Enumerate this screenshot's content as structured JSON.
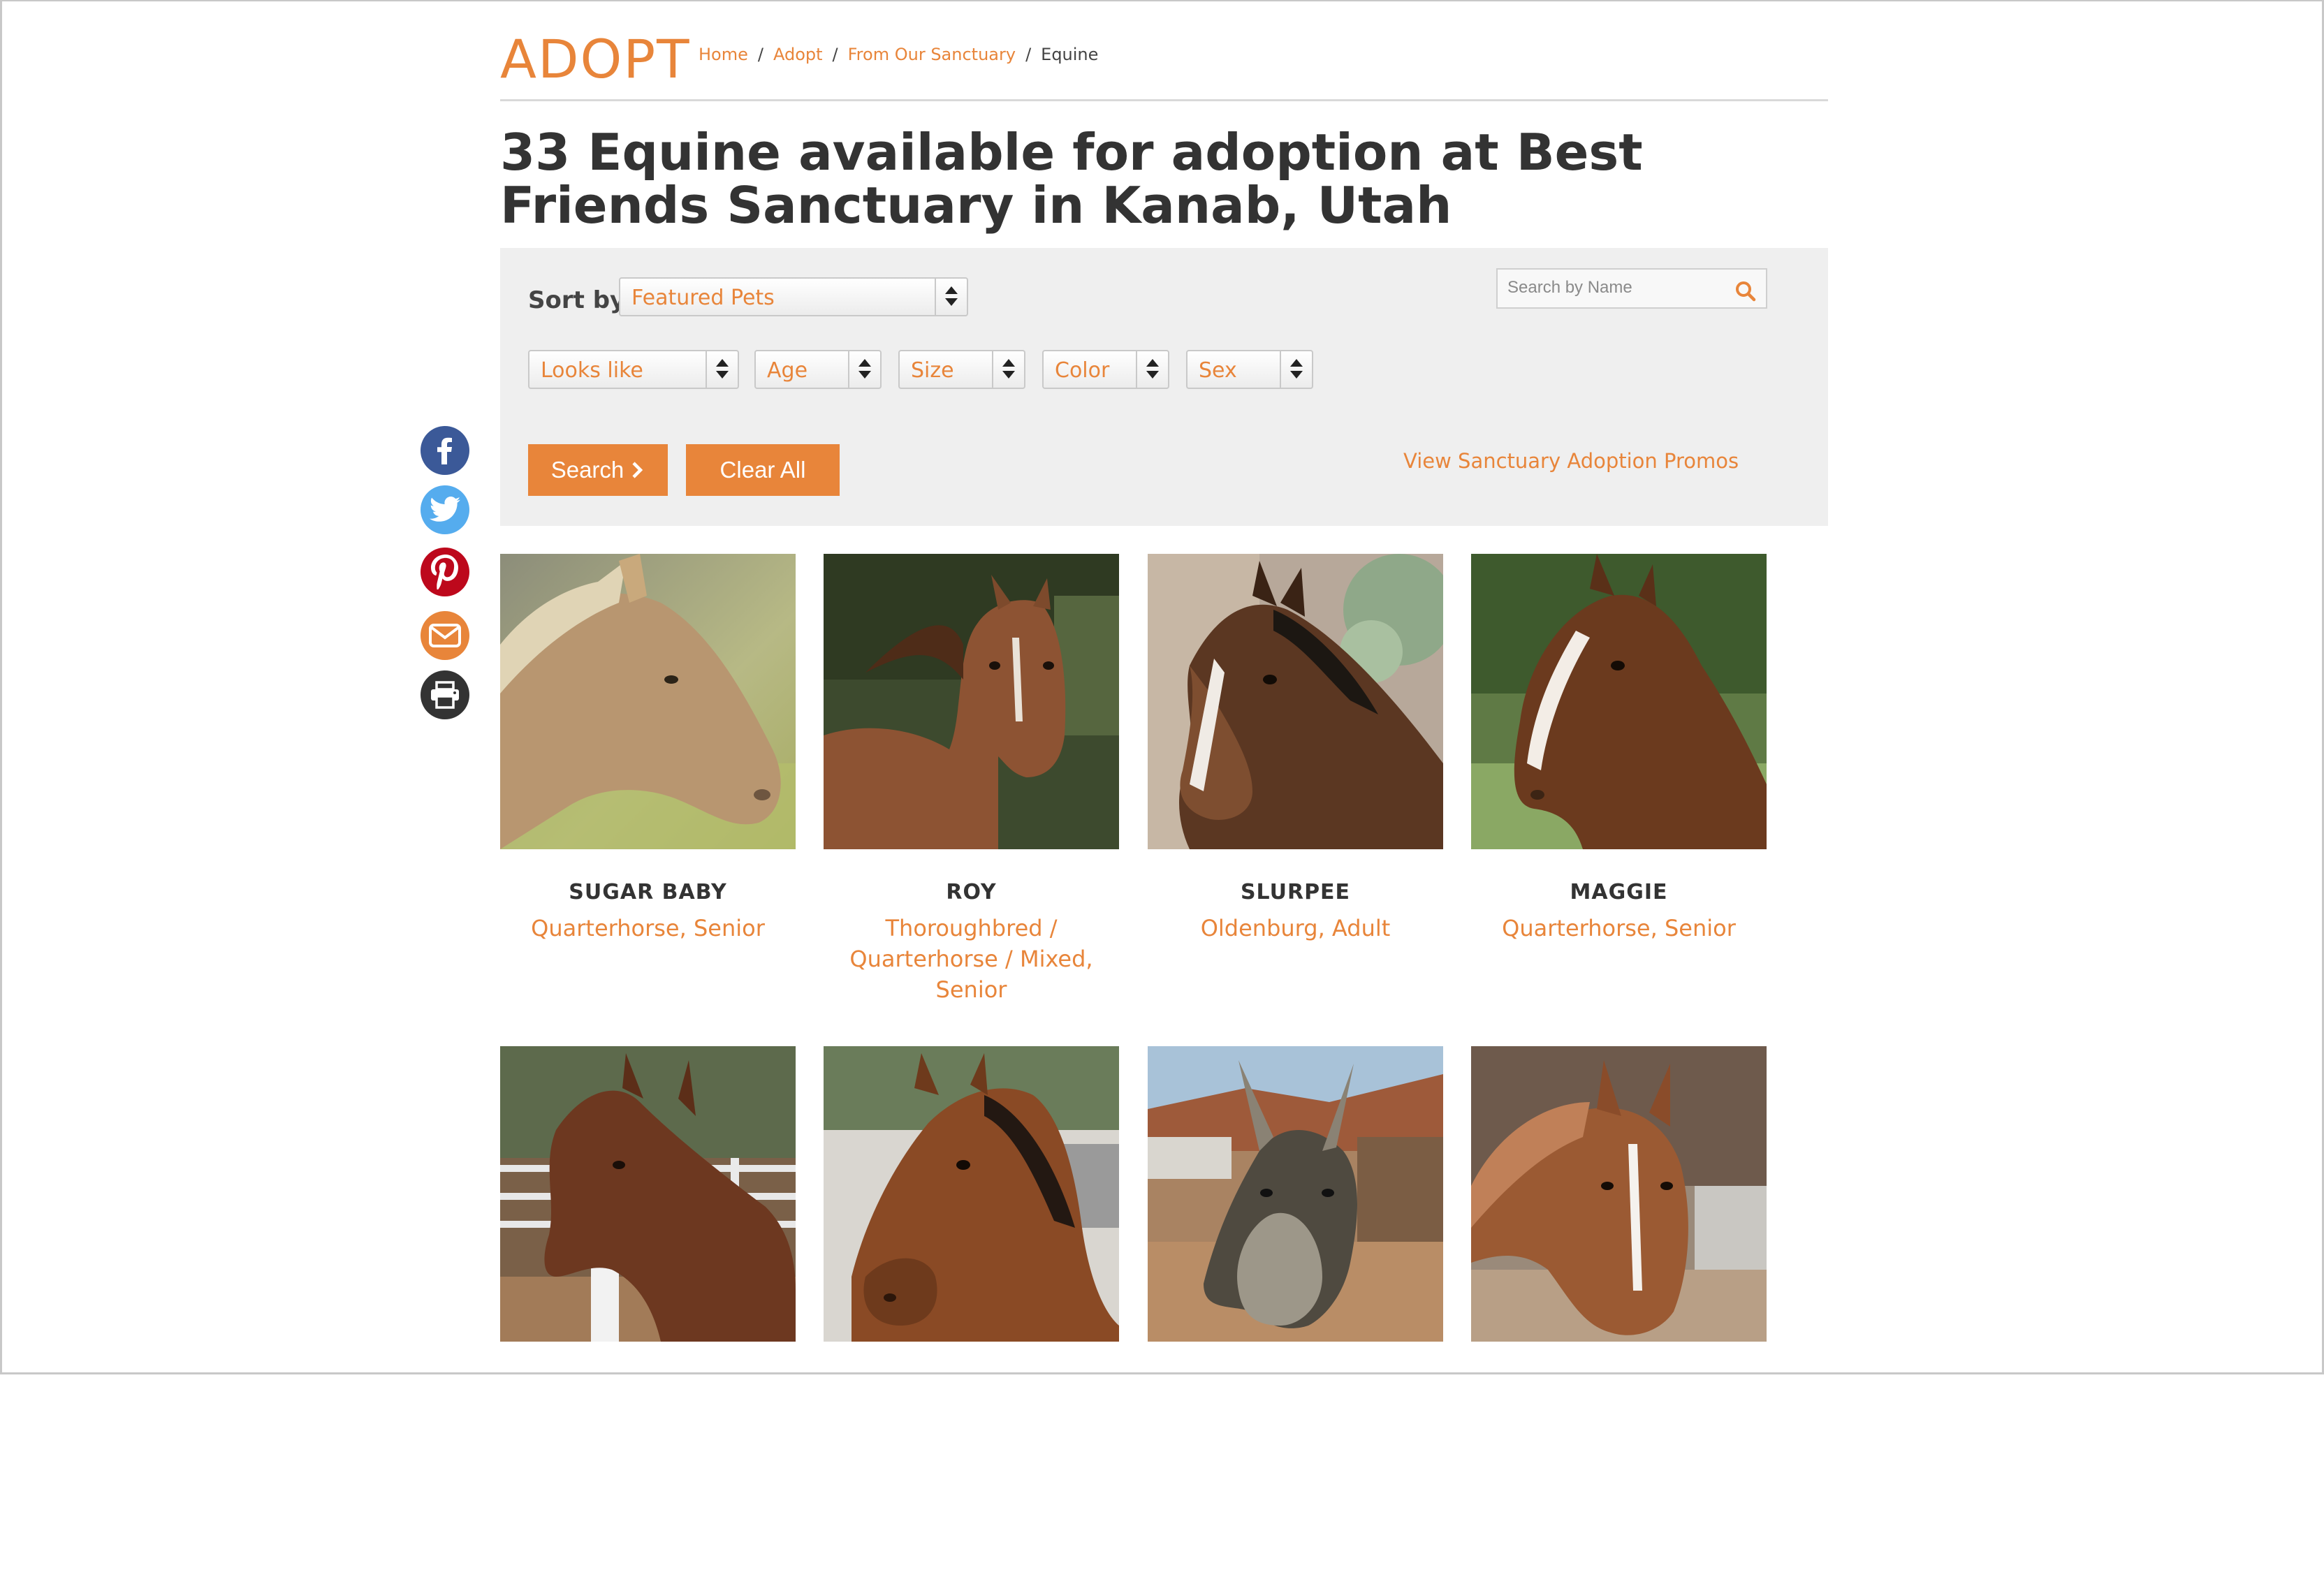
{
  "header": {
    "section_title": "ADOPT",
    "breadcrumb": [
      "Home",
      "Adopt",
      "From Our Sanctuary",
      "Equine"
    ],
    "separator": "/"
  },
  "page_title": "33 Equine available for adoption at Best Friends Sanctuary in Kanab, Utah",
  "filters": {
    "sort_label": "Sort by",
    "sort_value": "Featured Pets",
    "dropdowns": [
      "Looks like",
      "Age",
      "Size",
      "Color",
      "Sex"
    ],
    "search_placeholder": "Search by Name",
    "search_button": "Search",
    "clear_button": "Clear All",
    "promos_link": "View Sanctuary Adoption Promos"
  },
  "share": [
    "facebook-icon",
    "twitter-icon",
    "pinterest-icon",
    "email-icon",
    "print-icon"
  ],
  "colors": {
    "accent": "#e8853a",
    "facebook": "#3b5998",
    "twitter": "#55acee",
    "pinterest": "#bd081c",
    "print": "#333333"
  },
  "pets": [
    {
      "name": "SUGAR BABY",
      "desc": "Quarterhorse, Senior"
    },
    {
      "name": "ROY",
      "desc": "Thoroughbred / Quarterhorse / Mixed, Senior"
    },
    {
      "name": "SLURPEE",
      "desc": "Oldenburg, Adult"
    },
    {
      "name": "MAGGIE",
      "desc": "Quarterhorse, Senior"
    },
    {
      "name": "",
      "desc": ""
    },
    {
      "name": "",
      "desc": ""
    },
    {
      "name": "",
      "desc": ""
    },
    {
      "name": "",
      "desc": ""
    }
  ]
}
